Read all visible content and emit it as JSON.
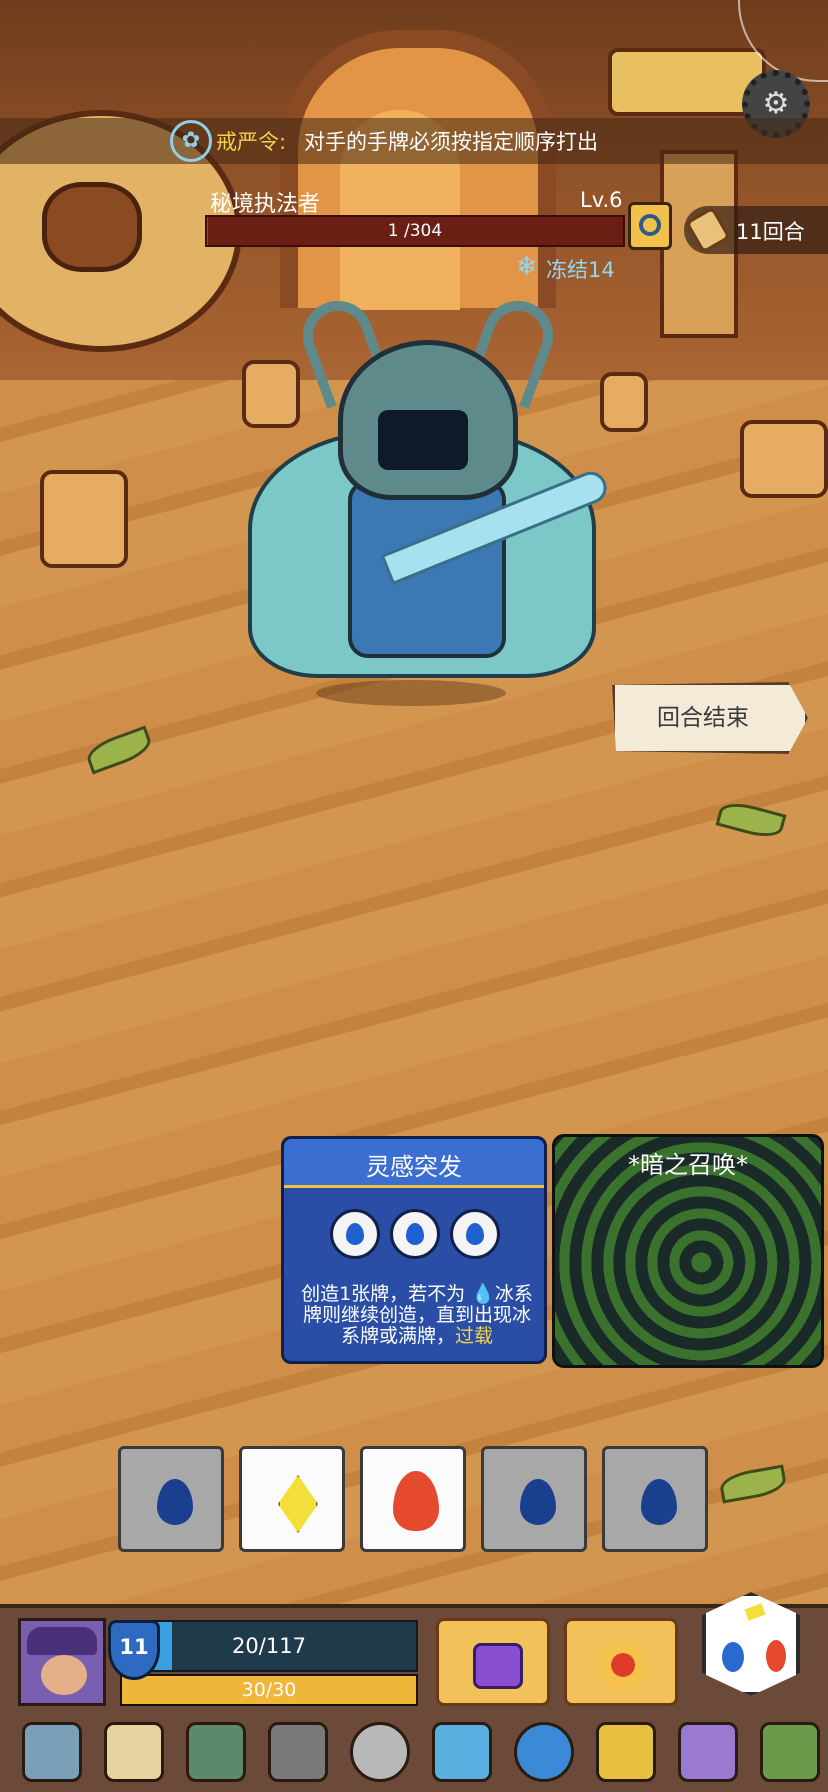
{
  "decree": {
    "title": "戒严令:",
    "text": "对手的手牌必须按指定顺序打出"
  },
  "enemy": {
    "name": "秘境执法者",
    "level": "Lv.6",
    "hp_text": "1 /304",
    "hp_fraction": 0.0033,
    "status": "冻结14"
  },
  "turn": {
    "label": "11回合"
  },
  "end_turn": {
    "label": "回合结束"
  },
  "cards": {
    "inspiration": {
      "title": "灵感突发",
      "cost_icon": "water-drop-icon",
      "cost_count": 3,
      "desc_1": "创造1张牌，若不为 ",
      "desc_ice": "冰",
      "desc_2": "系牌则继续创造，直到出现冰系牌或满牌，",
      "desc_over": "过载"
    },
    "dark": {
      "title": "*暗之召唤*"
    }
  },
  "dice_slots": [
    {
      "type": "water",
      "icon": "water-drop-icon"
    },
    {
      "type": "light",
      "icon": "yellow-diamond-icon"
    },
    {
      "type": "fire",
      "icon": "fire-icon"
    },
    {
      "type": "water",
      "icon": "water-drop-icon"
    },
    {
      "type": "water",
      "icon": "water-drop-icon"
    }
  ],
  "player": {
    "armor": "11",
    "hp_text": "20/117",
    "hp_fraction": 0.171,
    "energy_text": "30/30",
    "energy_fraction": 1.0
  },
  "skills": [
    {
      "icon": "purple-lock-icon"
    },
    {
      "icon": "explosion-burst-icon"
    }
  ],
  "relics": [
    "pickaxe-icon",
    "bone-scroll-icon",
    "potion-flask-icon",
    "iron-helmet-icon",
    "stone-coin-icon",
    "ice-crystal-icon",
    "water-drop-icon",
    "gold-amulet-icon",
    "purple-boot-icon",
    "green-book-icon"
  ],
  "colors": {
    "card_blue": "#2a4ea6",
    "accent_yellow": "#f6d24a",
    "ice_blue": "#8fd8f0"
  }
}
